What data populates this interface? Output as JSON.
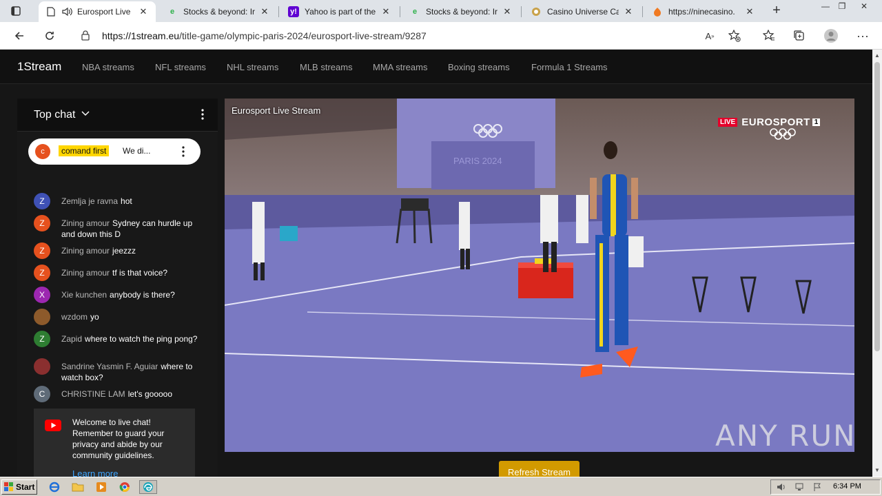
{
  "browser": {
    "tabs": [
      {
        "title": "Eurosport Live",
        "active": true,
        "favicon": "page-icon"
      },
      {
        "title": "Stocks & beyond: Ir",
        "active": false,
        "favicon": "green-e-icon"
      },
      {
        "title": "Yahoo is part of the",
        "active": false,
        "favicon": "yahoo-icon"
      },
      {
        "title": "Stocks & beyond: Ir",
        "active": false,
        "favicon": "green-e-icon"
      },
      {
        "title": "Casino Universe Ca",
        "active": false,
        "favicon": "casino-icon"
      },
      {
        "title": "https://ninecasino.",
        "active": false,
        "favicon": "ninecasino-icon"
      }
    ],
    "url_host": "https://1stream.eu",
    "url_path": "/title-game/olympic-paris-2024/eurosport-live-stream/9287",
    "colors": {
      "tabstrip": "#dfe3e8",
      "toolbar": "#ffffff"
    }
  },
  "site": {
    "brand": "1Stream",
    "nav": [
      "NBA streams",
      "NFL streams",
      "NHL streams",
      "MLB streams",
      "MMA streams",
      "Boxing streams",
      "Formula 1 Streams"
    ]
  },
  "chat": {
    "header": "Top chat",
    "pinned": {
      "initial": "c",
      "author": "comand first",
      "text": "We di..."
    },
    "messages": [
      {
        "initial": "Z",
        "author": "Zemlja je ravna",
        "text": "hot",
        "color": "#3f51b5"
      },
      {
        "initial": "Z",
        "author": "Zining amour",
        "text": "Sydney can hurdle up and down this D",
        "color": "#e6511e"
      },
      {
        "initial": "Z",
        "author": "Zining amour",
        "text": "jeezzz",
        "color": "#e6511e"
      },
      {
        "initial": "Z",
        "author": "Zining amour",
        "text": "tf is that voice?",
        "color": "#e6511e"
      },
      {
        "initial": "X",
        "author": "Xie kunchen",
        "text": "anybody is there?",
        "color": "#9c27b0"
      },
      {
        "initial": "",
        "author": "wzdom",
        "text": "yo",
        "color": "#8d5a2b"
      },
      {
        "initial": "Z",
        "author": "Zapid",
        "text": "where to watch the ping pong?",
        "color": "#2e7d32"
      },
      {
        "initial": "",
        "author": "Sandrine Yasmin F. Aguiar",
        "text": "where to watch box?",
        "color": "#8a2f2f"
      },
      {
        "initial": "C",
        "author": "CHRISTINE LAM",
        "text": "let's gooooo",
        "color": "#5f6b78"
      }
    ],
    "welcome": "Welcome to live chat! Remember to guard your privacy and abide by our community guidelines.",
    "learn_more": "Learn more"
  },
  "player": {
    "title": "Eurosport Live Stream",
    "live_badge": "LIVE",
    "channel": "EUROSPORT",
    "channel_number": "1",
    "venue_sign": "PARIS 2024"
  },
  "refresh_label": "Refresh Stream",
  "watermark": "ANY RUN",
  "taskbar": {
    "start": "Start",
    "clock": "6:34 PM",
    "apps": [
      "ie-icon",
      "folder-icon",
      "media-icon",
      "chrome-icon",
      "edge-icon"
    ]
  }
}
